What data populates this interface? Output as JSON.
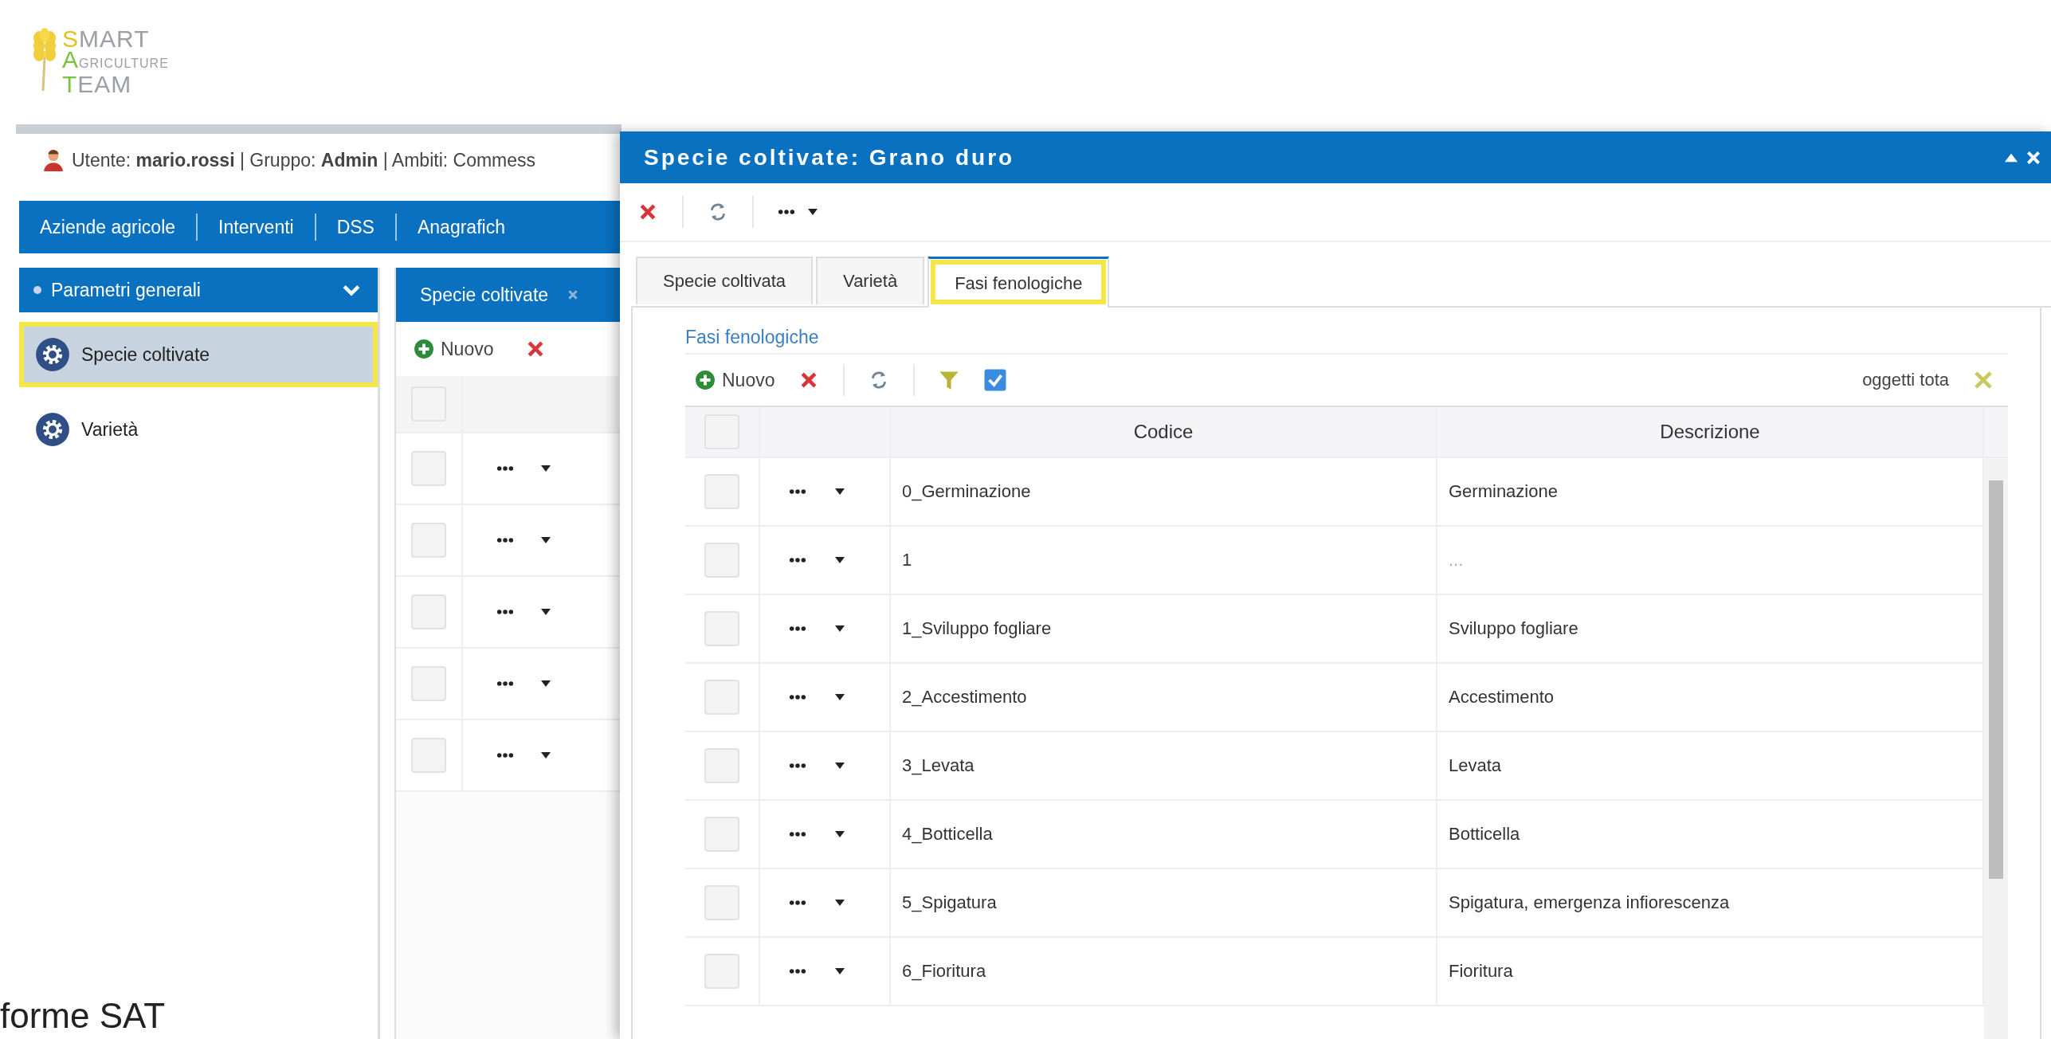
{
  "logo": {
    "lines": [
      "SMART",
      "AGRICULTURE",
      "TEAM"
    ]
  },
  "user_bar": {
    "text": "Utente: **mario.rossi** | Gruppo: **Admin** | Ambiti: Commess"
  },
  "nav": {
    "items": [
      "Aziende agricole",
      "Interventi",
      "DSS",
      "Anagrafich"
    ]
  },
  "sidebar": {
    "header": "Parametri generali",
    "items": [
      {
        "label": "Specie coltivate",
        "selected": true,
        "highlighted": true
      },
      {
        "label": "Varietà",
        "selected": false,
        "highlighted": false
      }
    ]
  },
  "background_panel": {
    "tab": "Specie coltivate",
    "new_label": "Nuovo",
    "header_checked": false,
    "rows": [
      {
        "checked": false
      },
      {
        "checked": false
      },
      {
        "checked": false
      },
      {
        "checked": false
      },
      {
        "checked": false
      }
    ]
  },
  "dialog": {
    "title": "Specie coltivate: Grano duro",
    "tabs": [
      {
        "label": "Specie coltivata",
        "selected": false,
        "highlighted": false
      },
      {
        "label": "Varietà",
        "selected": false,
        "highlighted": false
      },
      {
        "label": "Fasi fenologiche",
        "selected": true,
        "highlighted": true
      }
    ],
    "section_title": "Fasi fenologiche",
    "new_label": "Nuovo",
    "header_checked": false,
    "count_label": "oggetti tota",
    "columns": [
      "Codice",
      "Descrizione"
    ],
    "rows": [
      {
        "checked": false,
        "codice": "0_Germinazione",
        "descrizione": "Germinazione",
        "muted": false
      },
      {
        "checked": false,
        "codice": "1",
        "descrizione": "...",
        "muted": true
      },
      {
        "checked": false,
        "codice": "1_Sviluppo fogliare",
        "descrizione": "Sviluppo fogliare",
        "muted": false
      },
      {
        "checked": false,
        "codice": "2_Accestimento",
        "descrizione": "Accestimento",
        "muted": false
      },
      {
        "checked": false,
        "codice": "3_Levata",
        "descrizione": "Levata",
        "muted": false
      },
      {
        "checked": false,
        "codice": "4_Botticella",
        "descrizione": "Botticella",
        "muted": false
      },
      {
        "checked": false,
        "codice": "5_Spigatura",
        "descrizione": "Spigatura, emergenza infiorescenza",
        "muted": false
      },
      {
        "checked": false,
        "codice": "6_Fioritura",
        "descrizione": "Fioritura",
        "muted": false
      }
    ]
  },
  "caption": "forme SAT"
}
